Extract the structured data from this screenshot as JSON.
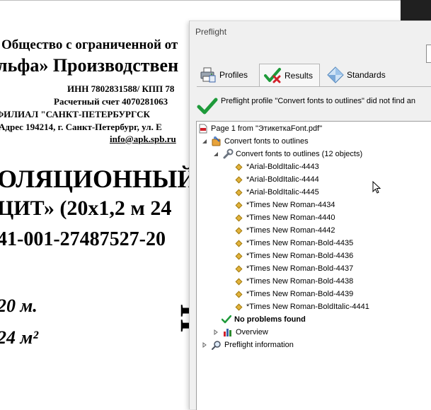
{
  "document": {
    "lines": [
      "Общество с ограниченной от",
      "льфа» Производствен",
      "ИНН 7802831588/ КПП 78",
      "Расчетный счет 4070281063",
      "ФИЛИАЛ \"САНКТ-ПЕТЕРБУРГСК",
      "Адрес 194214, г. Санкт-Петербург, ул. Е",
      "info@apk.spb.ru",
      "ОЛЯЦИОННЫЙ",
      "ЦИТ» (20х1,2 м 24",
      "41-001-27487527-20",
      "20 м.",
      "24 м²"
    ],
    "fragments": [
      "«",
      "Ц"
    ]
  },
  "panel": {
    "title": "Preflight",
    "tabs": [
      {
        "label": "Profiles",
        "icon": "printer-profiles-icon"
      },
      {
        "label": "Results",
        "icon": "checkmark-results-icon",
        "selected": true
      },
      {
        "label": "Standards",
        "icon": "diamond-standards-icon"
      }
    ],
    "status": "Preflight profile \"Convert fonts to outlines\" did not find an",
    "tree": {
      "page": "Page 1 from \"ЭтикеткаFont.pdf\"",
      "fixup_group": "Convert fonts to outlines",
      "fixup": "Convert fonts to outlines (12 objects)",
      "fonts": [
        "*Arial-BoldItalic-4443",
        "*Arial-BoldItalic-4444",
        "*Arial-BoldItalic-4445",
        "*Times New Roman-4434",
        "*Times New Roman-4440",
        "*Times New Roman-4442",
        "*Times New Roman-Bold-4435",
        "*Times New Roman-Bold-4436",
        "*Times New Roman-Bold-4437",
        "*Times New Roman-Bold-4438",
        "*Times New Roman-Bold-4439",
        "*Times New Roman-BoldItalic-4441"
      ],
      "no_problems": "No problems found",
      "overview": "Overview",
      "preflight_info": "Preflight information"
    }
  },
  "colors": {
    "check_green": "#1e9a3a",
    "pdf_red": "#d2202a",
    "font_diamond": "#e2b23a",
    "panel_bg": "#f0f0f0"
  }
}
